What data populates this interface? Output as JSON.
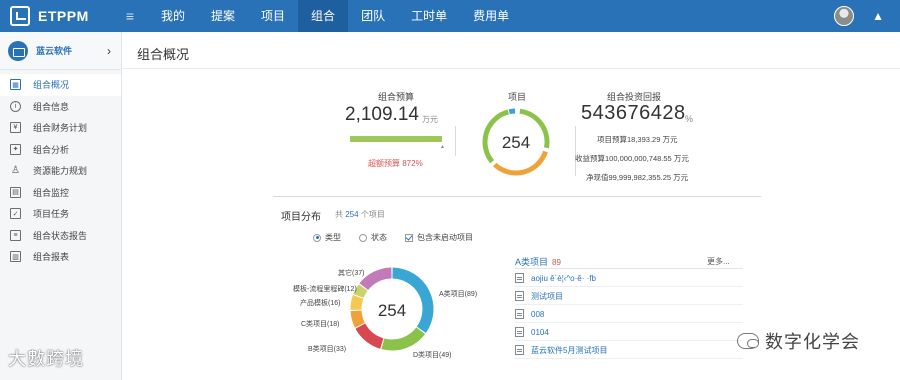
{
  "app": {
    "logo_text": "ETPPM",
    "logo_icon": "logo-icon",
    "menu_icon": "hamburger-icon"
  },
  "nav": {
    "items": [
      {
        "label": "我的",
        "active": false
      },
      {
        "label": "提案",
        "active": false
      },
      {
        "label": "项目",
        "active": false
      },
      {
        "label": "组合",
        "active": true
      },
      {
        "label": "团队",
        "active": false
      },
      {
        "label": "工时单",
        "active": false
      },
      {
        "label": "费用单",
        "active": false
      }
    ],
    "bell_icon": "bell-icon"
  },
  "sidebar": {
    "project_name": "蓝云软件",
    "arrow": "›",
    "items": [
      {
        "label": "组合概况",
        "icon": "grid-icon",
        "glyph": "▦",
        "active": true
      },
      {
        "label": "组合信息",
        "icon": "info-icon",
        "glyph": "i",
        "active": false
      },
      {
        "label": "组合财务计划",
        "icon": "finance-plan-icon",
        "glyph": "¥",
        "active": false
      },
      {
        "label": "组合分析",
        "icon": "analysis-icon",
        "glyph": "✦",
        "active": false
      },
      {
        "label": "资源能力规划",
        "icon": "person-icon",
        "glyph": "♙",
        "active": false
      },
      {
        "label": "组合监控",
        "icon": "monitor-icon",
        "glyph": "▤",
        "active": false
      },
      {
        "label": "项目任务",
        "icon": "task-check-icon",
        "glyph": "✓",
        "active": false
      },
      {
        "label": "组合状态报告",
        "icon": "status-report-icon",
        "glyph": "≡",
        "active": false
      },
      {
        "label": "组合报表",
        "icon": "report-icon",
        "glyph": "▥",
        "active": false
      }
    ]
  },
  "main": {
    "page_title": "组合概况",
    "budget": {
      "label": "组合预算",
      "value": "2,109.14",
      "unit": "万元",
      "bar_end": "▲",
      "warning": "超额预算 872%",
      "fill_fraction": 1.0
    },
    "projects": {
      "label": "项目",
      "count": "254"
    },
    "return": {
      "label": "组合投资回报",
      "value": "543676428",
      "unit": "%",
      "lines": [
        "项目预算18,393.29 万元",
        "收益预算100,000,000,748.55 万元",
        "净现值99,999,982,355.25 万元"
      ]
    },
    "distribution": {
      "title": "项目分布",
      "total_prefix": "共",
      "total": "254",
      "total_suffix": "个项目",
      "options": [
        {
          "label": "类型",
          "kind": "radio",
          "checked": true
        },
        {
          "label": "状态",
          "kind": "radio",
          "checked": false
        },
        {
          "label": "包含未启动项目",
          "kind": "checkbox",
          "checked": true
        }
      ],
      "center_label": "254"
    },
    "list": {
      "title": "A类项目",
      "count": "89",
      "more": "更多...",
      "items": [
        {
          "label": "aojiu ê´è¦‹^o·ê· ·fb",
          "icon": "doc-icon"
        },
        {
          "label": "测试项目",
          "icon": "doc-icon"
        },
        {
          "label": "008",
          "icon": "doc-icon"
        },
        {
          "label": "0104",
          "icon": "doc-icon"
        },
        {
          "label": "蓝云软件5月测试项目",
          "icon": "doc-icon"
        }
      ]
    }
  },
  "chart_data": {
    "type": "pie",
    "title": "",
    "center_label": "254",
    "slices": [
      {
        "label": "A类项目(89)",
        "value": 89,
        "color": "#3aa6d4"
      },
      {
        "label": "D类项目(49)",
        "value": 49,
        "color": "#8bc34a"
      },
      {
        "label": "B类项目(33)",
        "value": 33,
        "color": "#d9474f"
      },
      {
        "label": "C类项目(18)",
        "value": 18,
        "color": "#f0a23a"
      },
      {
        "label": "产品模板(16)",
        "value": 16,
        "color": "#f5c94f"
      },
      {
        "label": "模板-流程里程碑(12)",
        "value": 12,
        "color": "#c9d36a"
      },
      {
        "label": "其它(37)",
        "value": 37,
        "color": "#c27bb8"
      }
    ]
  },
  "gauge": {
    "colors": [
      "#8bc34a",
      "#f0a23a",
      "#d9474f",
      "#3aa6d4"
    ]
  },
  "watermarks": {
    "left": "大數跨境",
    "right": "数字化学会"
  }
}
